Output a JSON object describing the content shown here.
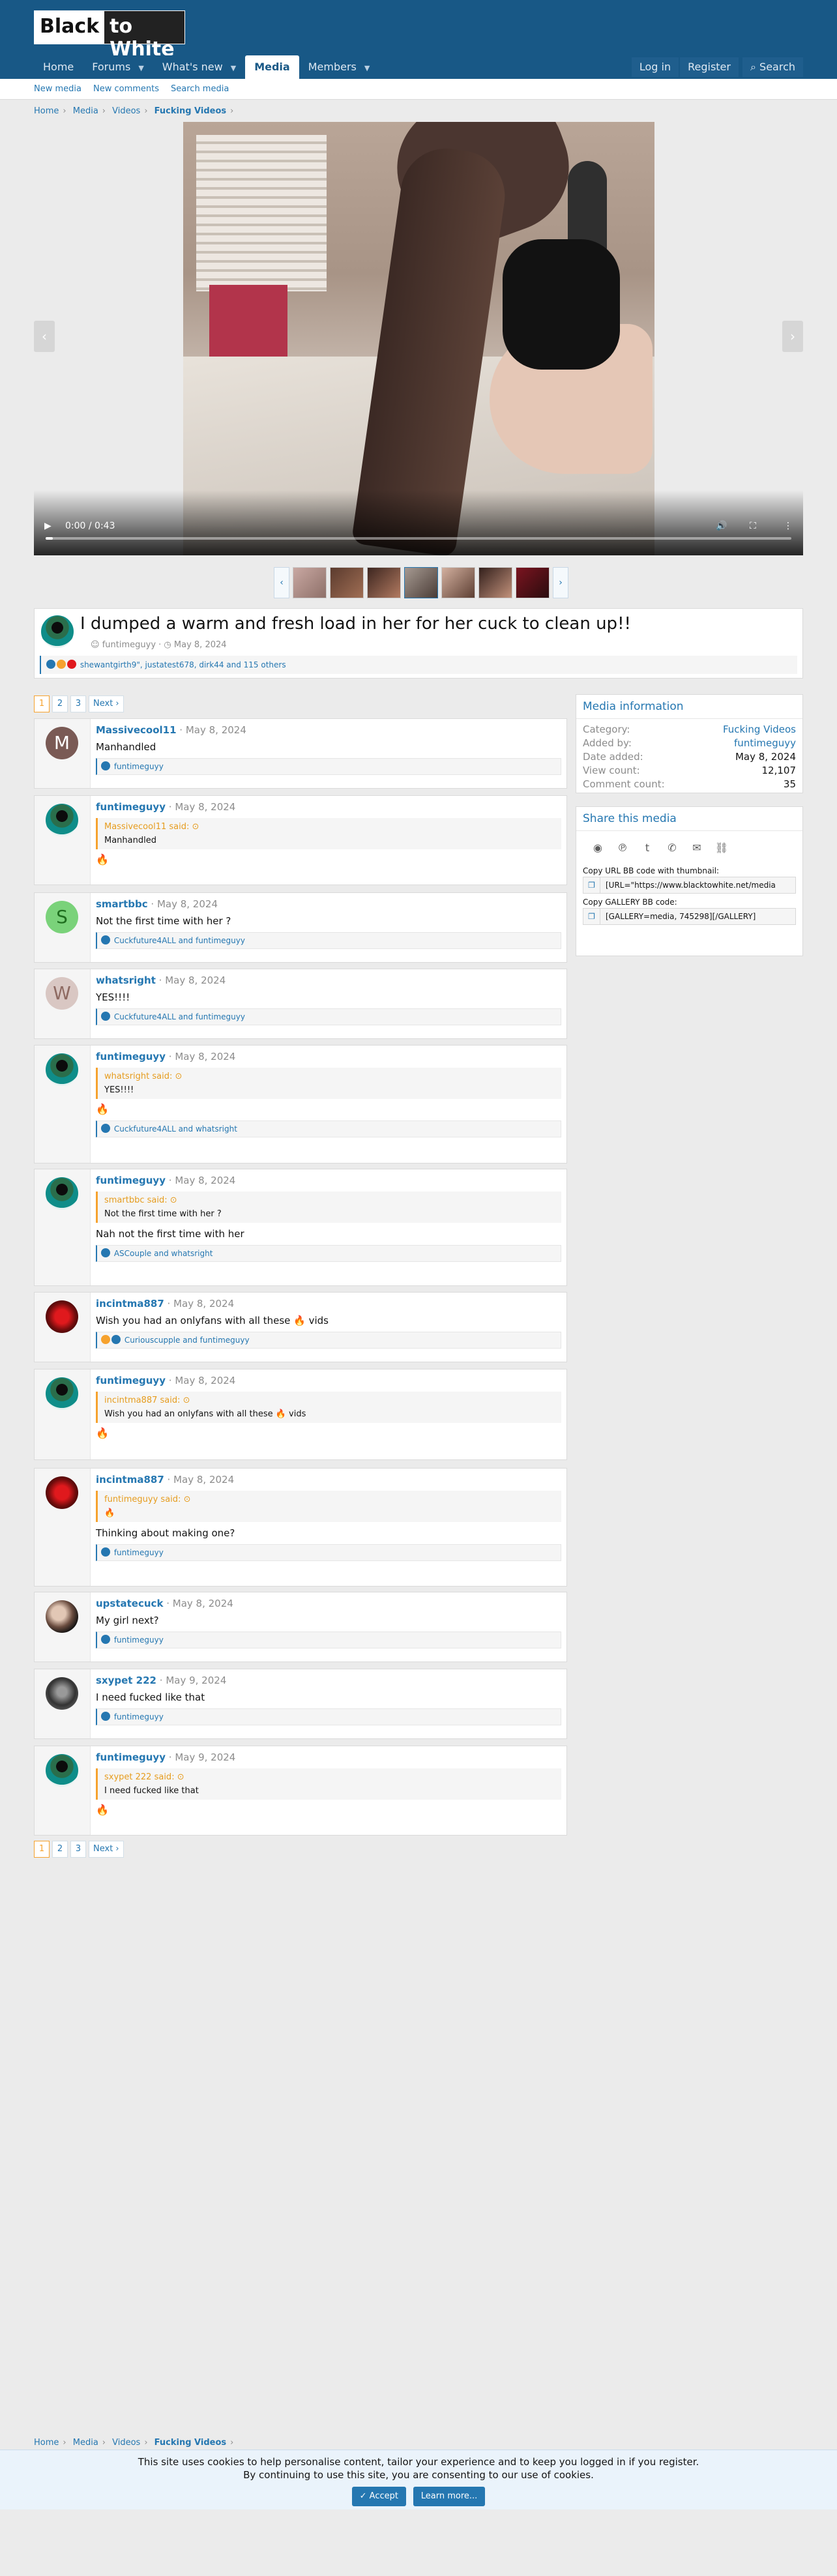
{
  "header": {
    "logo_left": "Black",
    "logo_right": "to White"
  },
  "nav": {
    "tabs": [
      {
        "label": "Home"
      },
      {
        "label": "Forums"
      },
      {
        "label": "What's new"
      },
      {
        "label": "Media"
      },
      {
        "label": "Members"
      }
    ],
    "login": "Log in",
    "register": "Register",
    "search": "Search"
  },
  "subnav": {
    "new_media": "New media",
    "new_comments": "New comments",
    "search_media": "Search media"
  },
  "breadcrumb": {
    "home": "Home",
    "media": "Media",
    "videos": "Videos",
    "category": "Fucking Videos"
  },
  "video": {
    "time": "0:00 / 0:43",
    "progress_fraction": 0.0
  },
  "media": {
    "title": "I dumped a warm and fresh load in her for her cuck to clean up!!",
    "author": "funtimeguyy",
    "date": "May 8, 2024",
    "reactions": "shewantgirth9\", justatest678, dirk44 and 115 others"
  },
  "pager": {
    "pages": [
      "1",
      "2",
      "3"
    ],
    "next": "Next ›"
  },
  "comments": [
    {
      "user": "Massivecool11",
      "date": "May 8, 2024",
      "text": "Manhandled",
      "reacted": "funtimeguyy",
      "avatar_letter": "M"
    },
    {
      "user": "funtimeguyy",
      "date": "May 8, 2024",
      "quote_head": "Massivecool11 said:",
      "quote": "Manhandled",
      "emoji": "🔥"
    },
    {
      "user": "smartbbc",
      "date": "May 8, 2024",
      "text": "Not the first time with her ?",
      "reacted": "Cuckfuture4ALL and funtimeguyy",
      "avatar_letter": "S"
    },
    {
      "user": "whatsright",
      "date": "May 8, 2024",
      "text": "YES!!!!",
      "reacted": "Cuckfuture4ALL and funtimeguyy",
      "avatar_letter": "W"
    },
    {
      "user": "funtimeguyy",
      "date": "May 8, 2024",
      "quote_head": "whatsright said:",
      "quote": "YES!!!!",
      "emoji": "🔥",
      "reacted": "Cuckfuture4ALL and whatsright"
    },
    {
      "user": "funtimeguyy",
      "date": "May 8, 2024",
      "quote_head": "smartbbc said:",
      "quote": "Not the first time with her ?",
      "text": "Nah not the first time with her",
      "reacted": "ASCouple and whatsright"
    },
    {
      "user": "incintma887",
      "date": "May 8, 2024",
      "text": "Wish you had an onlyfans with all these 🔥 vids",
      "reacted": "Curiouscupple and funtimeguyy"
    },
    {
      "user": "funtimeguyy",
      "date": "May 8, 2024",
      "quote_head": "incintma887 said:",
      "quote": "Wish you had an onlyfans with all these 🔥 vids",
      "emoji": "🔥"
    },
    {
      "user": "incintma887",
      "date": "May 8, 2024",
      "quote_head": "funtimeguyy said:",
      "quote": "🔥",
      "text": "Thinking about making one?",
      "reacted": "funtimeguyy"
    },
    {
      "user": "upstatecuck",
      "date": "May 8, 2024",
      "text": "My girl next?",
      "reacted": "funtimeguyy"
    },
    {
      "user": "sxypet 222",
      "date": "May 9, 2024",
      "text": "I need fucked like that",
      "reacted": "funtimeguyy"
    },
    {
      "user": "funtimeguyy",
      "date": "May 9, 2024",
      "quote_head": "sxypet 222 said:",
      "quote": "I need fucked like that",
      "emoji": "🔥"
    }
  ],
  "info": {
    "heading": "Media information",
    "rows": [
      {
        "k": "Category:",
        "v": "Fucking Videos"
      },
      {
        "k": "Added by:",
        "v": "funtimeguyy"
      },
      {
        "k": "Date added:",
        "v": "May 8, 2024"
      },
      {
        "k": "View count:",
        "v": "12,107"
      },
      {
        "k": "Comment count:",
        "v": "35"
      }
    ]
  },
  "share": {
    "heading": "Share this media",
    "url_label": "Copy URL BB code with thumbnail:",
    "url_value": "[URL=\"https://www.blacktowhite.net/media",
    "gallery_label": "Copy GALLERY BB code:",
    "gallery_value": "[GALLERY=media, 745298][/GALLERY]"
  },
  "cookie": {
    "line1": "This site uses cookies to help personalise content, tailor your experience and to keep you logged in if you register.",
    "line2": "By continuing to use this site, you are consenting to our use of cookies.",
    "accept": "✓ Accept",
    "learn": "Learn more..."
  },
  "colors": {
    "header": "#185886",
    "link": "#2577b1",
    "quote_accent": "#f6a22e"
  }
}
